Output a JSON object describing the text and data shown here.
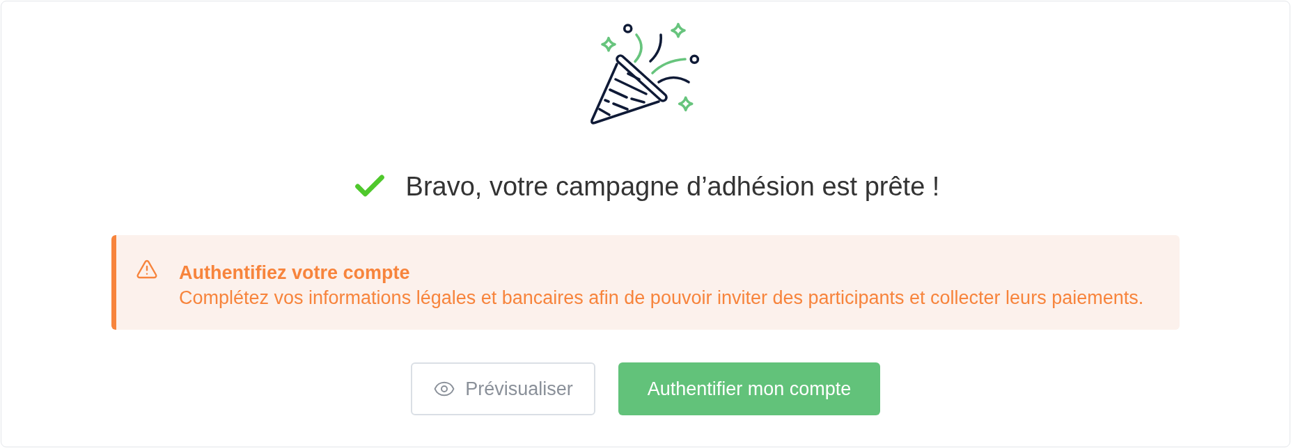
{
  "heading": {
    "text": "Bravo, votre campagne d’adhésion est prête !"
  },
  "alert": {
    "kind": "warning",
    "title": "Authentifiez votre compte",
    "message": "Complétez vos informations légales et bancaires afin de pouvoir inviter des participants et collecter leurs paiements."
  },
  "buttons": [
    {
      "kind": "secondary",
      "label": "Prévisualiser"
    },
    {
      "kind": "primary",
      "label": "Authentifier mon compte"
    }
  ]
}
